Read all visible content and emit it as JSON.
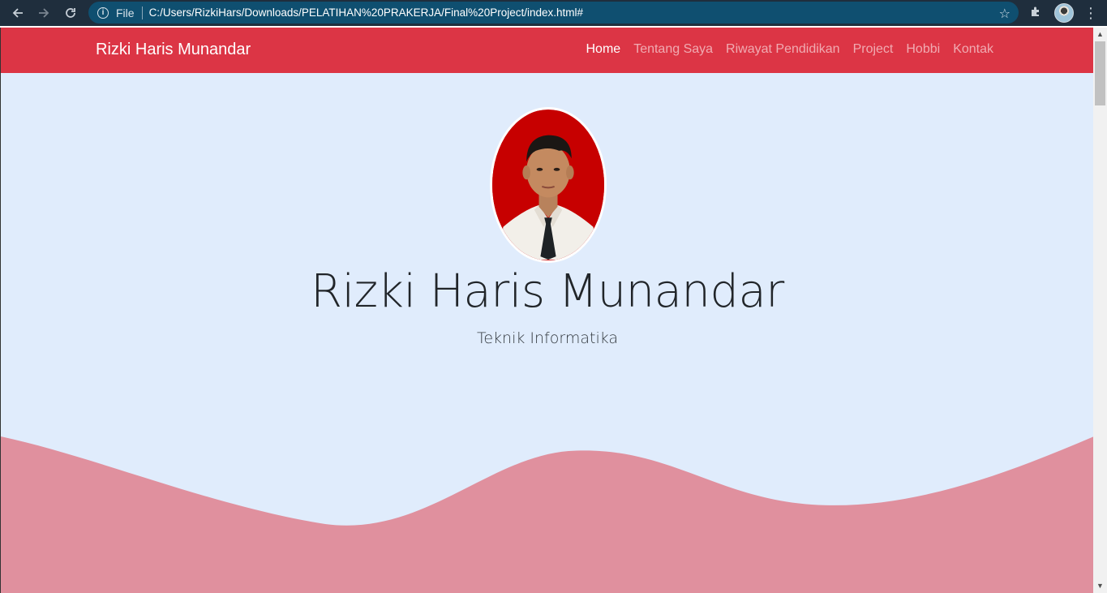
{
  "browser": {
    "file_label": "File",
    "url": "C:/Users/RizkiHars/Downloads/PELATIHAN%20PRAKERJA/Final%20Project/index.html#",
    "icons": [
      "back-arrow-icon",
      "forward-arrow-icon",
      "reload-icon",
      "info-icon",
      "star-icon",
      "extensions-icon",
      "profile-avatar",
      "menu-dots-icon"
    ]
  },
  "navbar": {
    "brand": "Rizki Haris Munandar",
    "links": [
      {
        "label": "Home",
        "active": true
      },
      {
        "label": "Tentang Saya",
        "active": false
      },
      {
        "label": "Riwayat Pendidikan",
        "active": false
      },
      {
        "label": "Project",
        "active": false
      },
      {
        "label": "Hobbi",
        "active": false
      },
      {
        "label": "Kontak",
        "active": false
      }
    ]
  },
  "hero": {
    "name": "Rizki Haris Munandar",
    "subtitle": "Teknik Informatika"
  },
  "colors": {
    "navbar": "#dc3545",
    "hero_background": "#e0ecfc",
    "wave": "#e0909e",
    "omnibox": "#0f4f70"
  }
}
